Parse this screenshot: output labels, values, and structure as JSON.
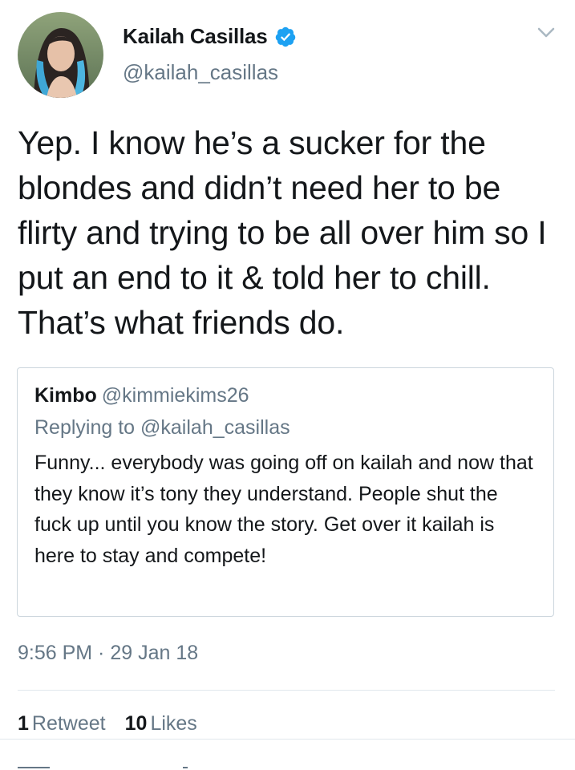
{
  "author": {
    "display_name": "Kailah Casillas",
    "handle": "@kailah_casillas",
    "verified_icon": "verified-badge-icon",
    "verified_color": "#1da1f2"
  },
  "tweet": {
    "text": "Yep. I know he’s a sucker for the blondes and didn’t need her to be flirty and trying to be all over him so I put an end to it & told her to chill. That’s what friends do.",
    "timestamp": "9:56 PM · 29 Jan 18"
  },
  "quoted_tweet": {
    "name": "Kimbo",
    "handle": "@kimmiekims26",
    "replying_to": "Replying to @kailah_casillas",
    "text": "Funny... everybody was going off on kailah and now that they know it’s tony they understand. People shut the fuck up until you know the story. Get over it kailah is here to stay and compete!"
  },
  "stats": {
    "retweets_count": "1",
    "retweets_label": "Retweet",
    "likes_count": "10",
    "likes_label": "Likes"
  },
  "colors": {
    "text_primary": "#14171a",
    "text_secondary": "#657786",
    "border": "#ccd6dd",
    "divider": "#e1e8ed"
  }
}
